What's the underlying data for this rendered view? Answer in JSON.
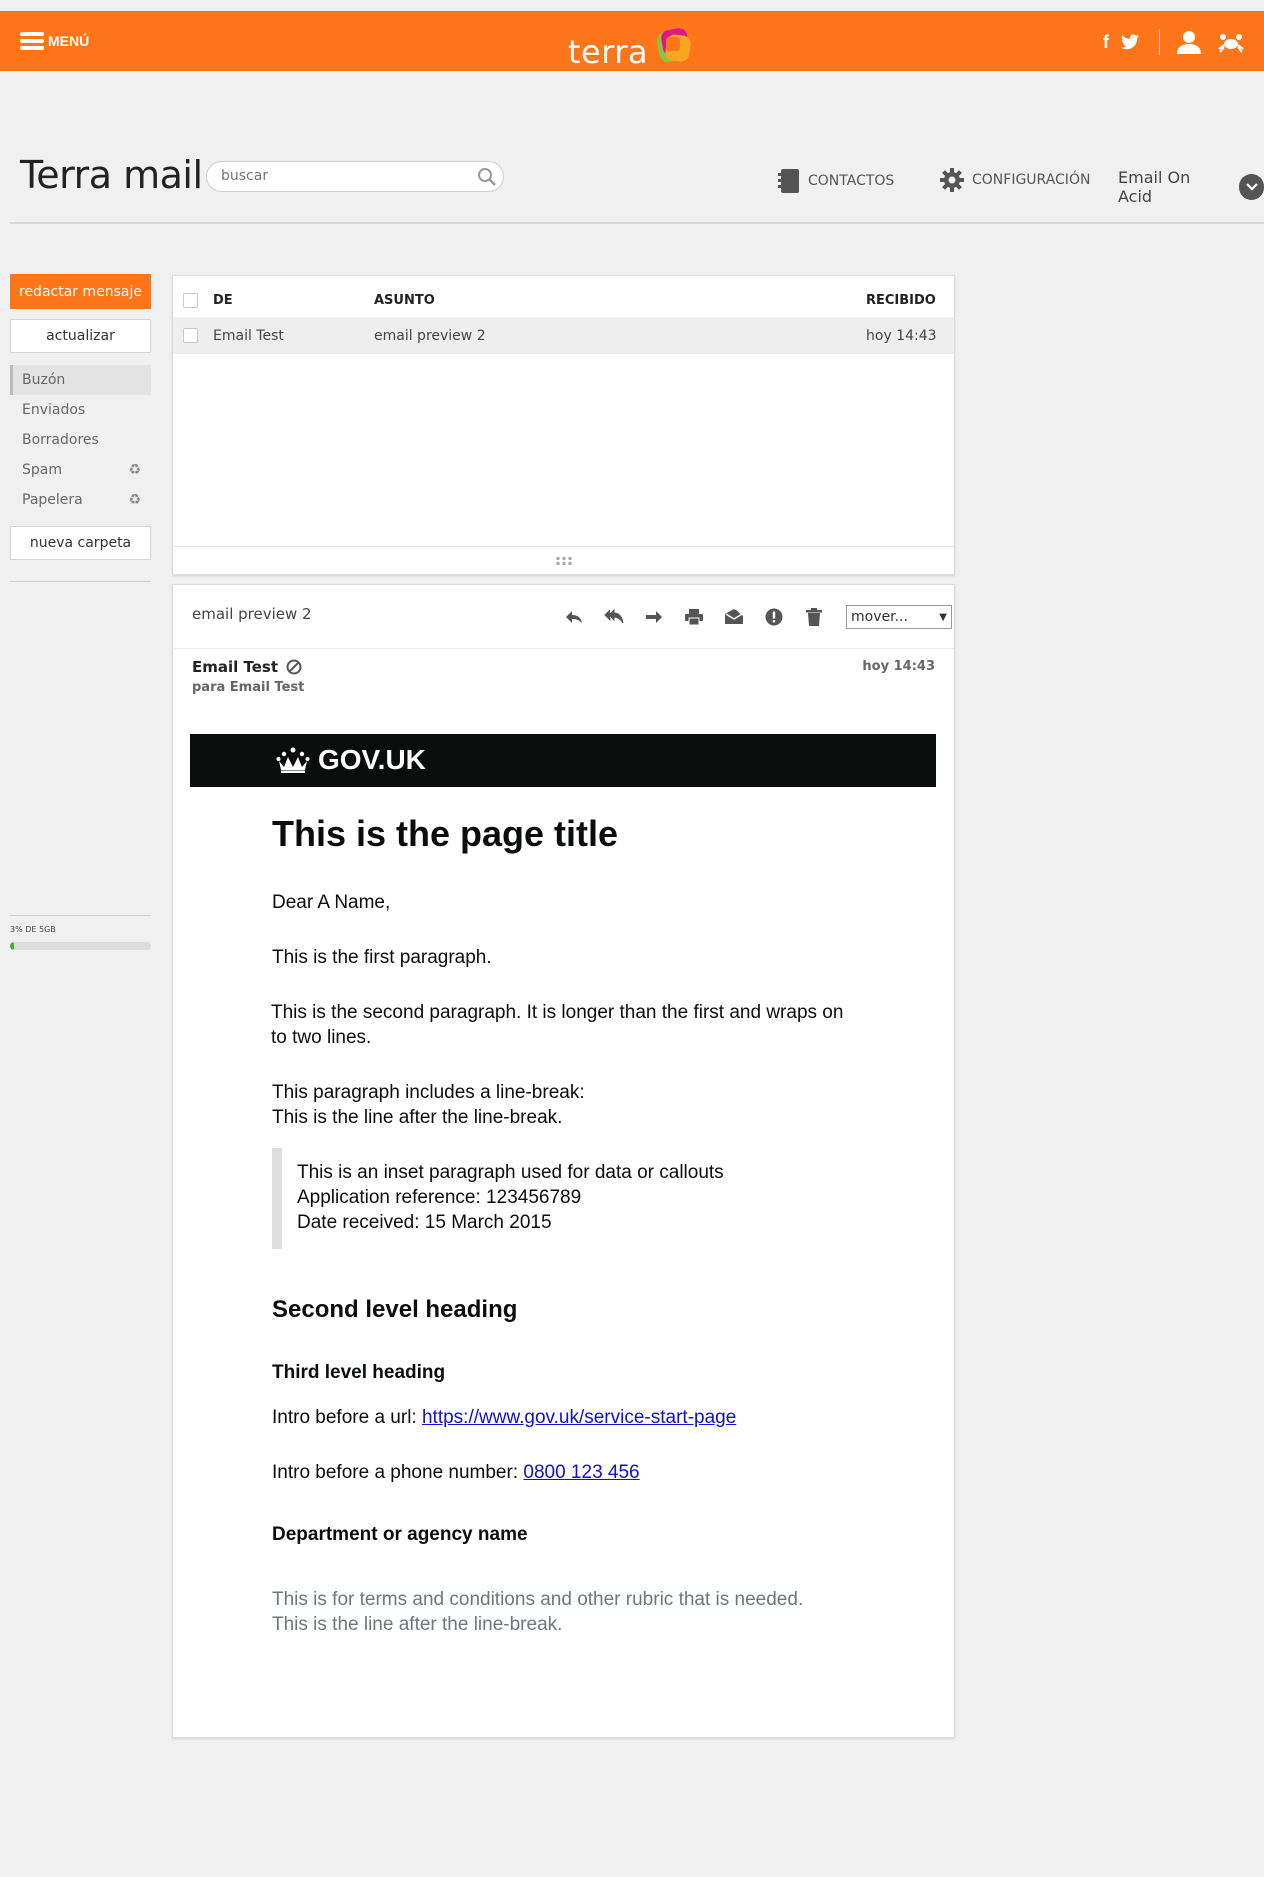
{
  "topbar": {
    "menu_label": "MENÚ",
    "logo_text": "terra",
    "colors": {
      "bar": "#ff7519"
    }
  },
  "header": {
    "app_title": "Terra mail",
    "search_placeholder": "buscar",
    "contacts_label": "CONTACTOS",
    "settings_label": "CONFIGURACIÓN",
    "user_name": "Email On Acid"
  },
  "sidebar": {
    "compose_label": "redactar mensaje",
    "refresh_label": "actualizar",
    "folders": [
      {
        "label": "Buzón",
        "active": true
      },
      {
        "label": "Enviados"
      },
      {
        "label": "Borradores"
      },
      {
        "label": "Spam",
        "icon": "recycle-icon"
      },
      {
        "label": "Papelera",
        "icon": "recycle-icon"
      }
    ],
    "new_folder_label": "nueva carpeta",
    "quota_text": "3% DE 5GB",
    "quota_fraction": 0.03
  },
  "message_list": {
    "headers": {
      "from": "DE",
      "subject": "ASUNTO",
      "received": "RECIBIDO"
    },
    "rows": [
      {
        "from": "Email Test",
        "subject": "email preview 2",
        "received": "hoy 14:43"
      }
    ]
  },
  "reader": {
    "subject": "email preview 2",
    "move_label": "mover...",
    "sender": "Email Test",
    "recipient": "para Email Test",
    "date": "hoy 14:43",
    "toolbar_icons": [
      "reply-icon",
      "reply-all-icon",
      "forward-icon",
      "print-icon",
      "mark-unread-icon",
      "report-icon",
      "trash-icon"
    ]
  },
  "email": {
    "brand": "GOV.UK",
    "title": "This is the page title",
    "greeting": "Dear A Name,",
    "p1": "This is the first paragraph.",
    "p2": "This is the second paragraph. It is longer than the first and wraps on to two lines.",
    "p3_line1": "This paragraph includes a line-break:",
    "p3_line2": "This is the line after the line-break.",
    "inset_line1": "This is an inset paragraph used for data or callouts",
    "inset_line2": "Application reference: 123456789",
    "inset_line3": "Date received: 15 March 2015",
    "h2": "Second level heading",
    "h3": "Third level heading",
    "url_intro": "Intro before a url: ",
    "url_text": "https://www.gov.uk/service-start-page",
    "phone_intro": "Intro before a phone number: ",
    "phone_text": "0800 123 456",
    "department": "Department or agency name",
    "terms_line1": "This is for terms and conditions and other rubric that is needed.",
    "terms_line2": "This is the line after the line-break."
  }
}
